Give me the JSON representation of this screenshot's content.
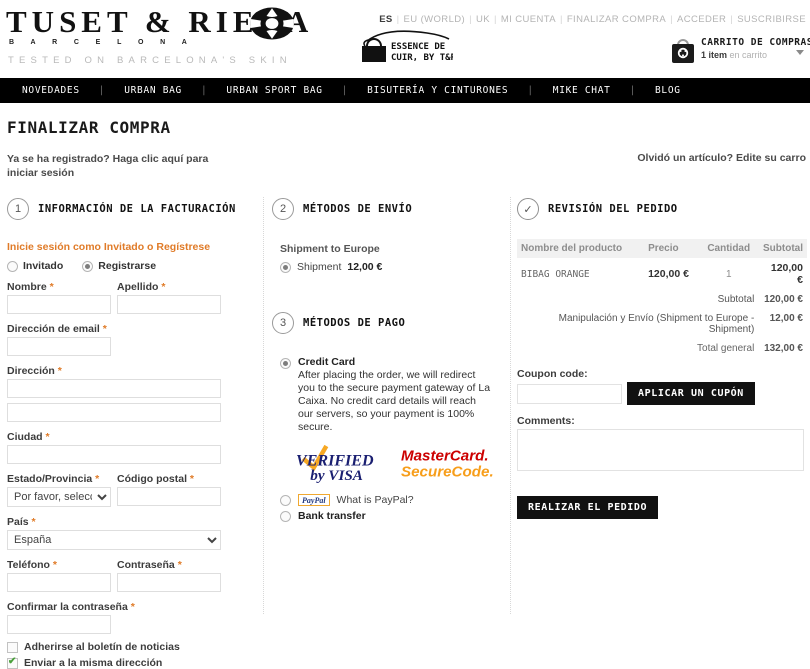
{
  "header": {
    "logo_main": "TUSET & RIERA",
    "logo_sub": "B A R C E L O N A",
    "logo_tagline": "TESTED ON BARCELONA'S SKIN",
    "wheel_icon": "wheel-icon",
    "essence_line1": "ESSENCE DE",
    "essence_line2": "CUIR, BY T&R",
    "topnav": [
      {
        "label": "ES",
        "active": true
      },
      {
        "label": "EU (WORLD)",
        "active": false
      },
      {
        "label": "UK",
        "active": false
      },
      {
        "label": "MI CUENTA",
        "active": false
      },
      {
        "label": "FINALIZAR COMPRA",
        "active": false
      },
      {
        "label": "ACCEDER",
        "active": false
      },
      {
        "label": "SUSCRIBIRSE",
        "active": false
      }
    ],
    "cart": {
      "icon": "shopping-bag-icon",
      "title": "CARRITO DE COMPRAS",
      "count": "1 item",
      "suffix": " en carrito",
      "caret": "chevron-down-icon"
    }
  },
  "mainnav": [
    "NOVEDADES",
    "URBAN BAG",
    "URBAN SPORT BAG",
    "BISUTERÍA Y CINTURONES",
    "MIKE CHAT",
    "BLOG"
  ],
  "page": {
    "title": "FINALIZAR COMPRA",
    "login_prompt": "Ya se ha registrado? Haga clic aquí para iniciar sesión",
    "edit_cart": "Olvidó un artículo? Edite su carro"
  },
  "billing": {
    "step_num": "1",
    "step_title": "INFORMACIÓN DE LA FACTURACIÓN",
    "guest_note": "Inicie sesión como Invitado o Regístrese",
    "radio_guest": "Invitado",
    "radio_register": "Registrarse",
    "fields": {
      "first_name": "Nombre",
      "last_name": "Apellido",
      "email": "Dirección de email",
      "address": "Dirección",
      "city": "Ciudad",
      "state": "Estado/Provincia",
      "zip": "Código postal",
      "country": "País",
      "phone": "Teléfono",
      "password": "Contraseña",
      "confirm_password": "Confirmar la contraseña"
    },
    "values": {
      "first_name": "",
      "last_name": "",
      "email": "",
      "address1": "",
      "address2": "",
      "city": "",
      "state": "Por favor, seleccione",
      "zip": "",
      "country": "España",
      "phone": "",
      "password": "",
      "confirm_password": ""
    },
    "required_mark": "*",
    "checkbox_newsletter": "Adherirse al boletín de noticias",
    "checkbox_same_address": "Enviar a la misma dirección"
  },
  "shipping": {
    "step_num": "2",
    "step_title": "MÉTODOS DE ENVÍO",
    "group_label": "Shipment to Europe",
    "option_label": "Shipment",
    "option_price": "12,00 €"
  },
  "payment": {
    "step_num": "3",
    "step_title": "MÉTODOS DE PAGO",
    "credit_card_label": "Credit Card",
    "credit_card_desc": "After placing the order, we will redirect you to the secure payment gateway of La Caixa. No credit card details will reach our servers, so your payment is 100% secure.",
    "visa_line1": "VERIFIED",
    "visa_line2": "by VISA",
    "mc_line1": "MasterCard.",
    "mc_line2": "SecureCode.",
    "paypal_badge": "PayPal",
    "paypal_link": "What is PayPal?",
    "bank_transfer": "Bank transfer"
  },
  "review": {
    "step_icon": "check-circle-icon",
    "step_title": "REVISIÓN DEL PEDIDO",
    "columns": [
      "Nombre del producto",
      "Precio",
      "Cantidad",
      "Subtotal"
    ],
    "rows": [
      {
        "name": "BIBAG ORANGE",
        "price": "120,00 €",
        "qty": "1",
        "subtotal": "120,00 €"
      }
    ],
    "totals": [
      {
        "label": "Subtotal",
        "value": "120,00 €"
      },
      {
        "label": "Manipulación y Envío (Shipment to Europe - Shipment)",
        "value": "12,00 €"
      },
      {
        "label": "Total general",
        "value": "132,00 €"
      }
    ],
    "coupon_label": "Coupon code:",
    "coupon_value": "",
    "coupon_button": "APLICAR UN CUPÓN",
    "comments_label": "Comments:",
    "comments_value": "",
    "place_order_button": "REALIZAR EL PEDIDO"
  }
}
